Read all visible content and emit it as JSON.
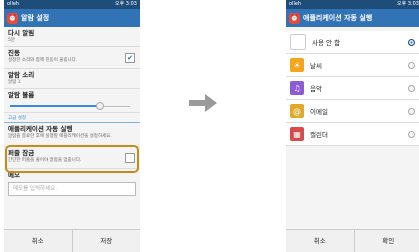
{
  "status_bar": {
    "carrier": "olleh",
    "time": "오후 3:03"
  },
  "left_screen": {
    "title": "알람 설정",
    "settings": [
      {
        "label": "다시 알림",
        "sub": "5분"
      },
      {
        "label": "진동",
        "sub": "설정한 소리와 함께 진동이 울립니다.",
        "checked": true
      },
      {
        "label": "알람 소리",
        "sub": "알람 1"
      },
      {
        "label": "알람 볼륨",
        "volume_percent": 75
      }
    ],
    "section_header": "고급 설정",
    "auto_app": {
      "label": "애플리케이션 자동 실행",
      "sub": "알람을 종료한 후에 실행할 애플리케이션을 설정하세요."
    },
    "puzzle_lock": {
      "label": "퍼즐 잠금",
      "sub": "간단한 퍼즐을 풀어야 알람을 멈춥니다.",
      "checked": false
    },
    "memo": {
      "label": "메모",
      "placeholder": "메모를 입력하세요."
    },
    "buttons": {
      "cancel": "취소",
      "save": "저장"
    }
  },
  "right_screen": {
    "title": "애플리케이션 자동 실행",
    "apps": [
      {
        "label": "사용 안 함",
        "selected": true,
        "icon": "blank-icon"
      },
      {
        "label": "날씨",
        "selected": false,
        "icon": "weather-icon",
        "color": "#f3a51c"
      },
      {
        "label": "음악",
        "selected": false,
        "icon": "music-icon",
        "color": "#8e5ad8"
      },
      {
        "label": "이메일",
        "selected": false,
        "icon": "email-icon",
        "color": "#e0a92a"
      },
      {
        "label": "캘린더",
        "selected": false,
        "icon": "calendar-icon",
        "color": "#d94a4a"
      }
    ],
    "buttons": {
      "cancel": "취소",
      "confirm": "확인"
    }
  },
  "colors": {
    "status_bar": "#1f4d7a",
    "title_bar": "#3273b5",
    "highlight": "#c98b1c",
    "accent": "#2a6db6"
  }
}
